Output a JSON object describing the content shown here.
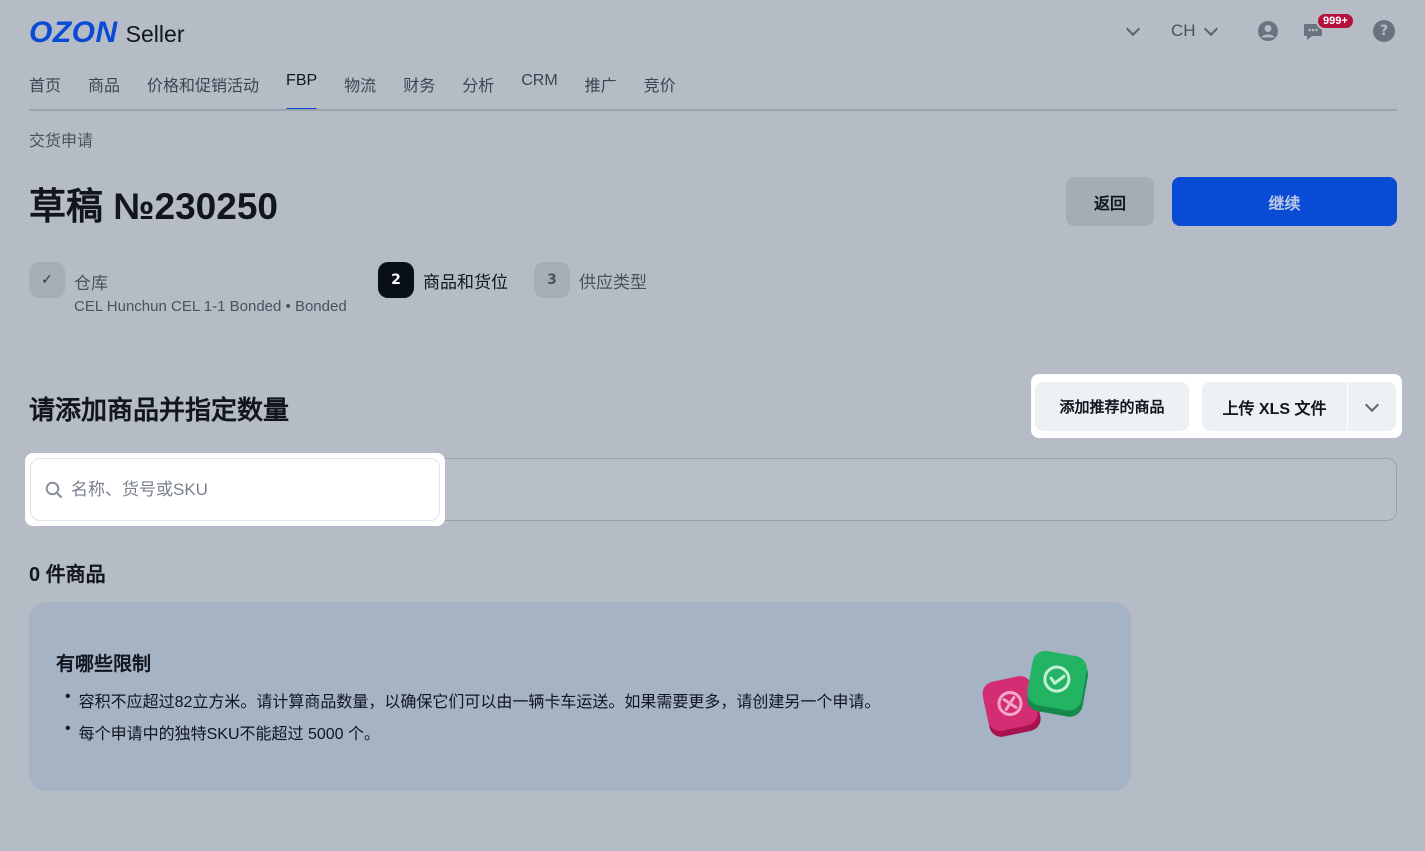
{
  "header": {
    "logo_brand": "OZON",
    "logo_product": "Seller",
    "lang": "CH",
    "notification_badge": "999+",
    "help_icon": "help-icon",
    "profile_icon": "user-icon",
    "chat_icon": "chat-icon"
  },
  "nav": {
    "items": [
      "首页",
      "商品",
      "价格和促销活动",
      "FBP",
      "物流",
      "财务",
      "分析",
      "CRM",
      "推广",
      "竞价"
    ],
    "active": "FBP"
  },
  "breadcrumb": "交货申请",
  "page": {
    "title": "草稿 №230250",
    "back_label": "返回",
    "continue_label": "继续"
  },
  "steps": [
    {
      "marker": "✓",
      "label": "仓库",
      "sub": "CEL Hunchun CEL 1-1 Bonded • Bonded",
      "state": "done"
    },
    {
      "marker": "2",
      "label": "商品和货位",
      "sub": "",
      "state": "active"
    },
    {
      "marker": "3",
      "label": "供应类型",
      "sub": "",
      "state": "todo"
    }
  ],
  "section": {
    "title": "请添加商品并指定数量",
    "add_recommended_label": "添加推荐的商品",
    "upload_label": "上传 XLS 文件"
  },
  "search": {
    "placeholder": "名称、货号或SKU"
  },
  "count_label": "0 件商品",
  "info": {
    "title": "有哪些限制",
    "items": [
      "容积不应超过82立方米。请计算商品数量，以确保它们可以由一辆卡车运送。如果需要更多，请创建另一个申请。",
      "每个申请中的独特SKU不能超过 5000 个。"
    ]
  },
  "colors": {
    "accent": "#0a4bd6",
    "badge": "#b4103c",
    "background": "#b5bcc5"
  }
}
